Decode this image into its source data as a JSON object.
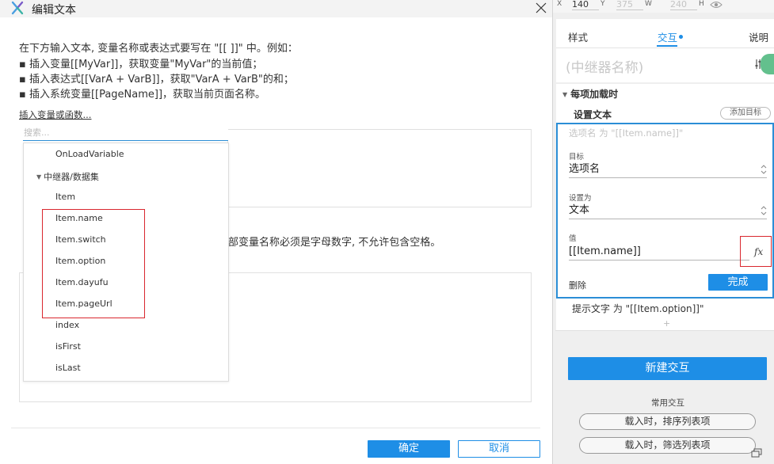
{
  "dialog": {
    "title": "编辑文本",
    "instructions": [
      "在下方输入文本, 变量名称或表达式要写在 \"[[ ]]\" 中。例如：",
      "▪ 插入变量[[MyVar]]，获取变量\"MyVar\"的当前值；",
      "▪ 插入表达式[[VarA + VarB]]，获取\"VarA + VarB\"的和；",
      "▪ 插入系统变量[[PageName]]，获取当前页面名称。"
    ],
    "insert_link": "插入变量或函数...",
    "local_var_note": "部变量名称必须是字母数字, 不允许包含空格。",
    "ok_label": "确定",
    "cancel_label": "取消"
  },
  "dropdown": {
    "search_placeholder": "搜索...",
    "items": [
      {
        "label": "OnLoadVariable",
        "group": false
      },
      {
        "label": "中继器/数据集",
        "group": true
      },
      {
        "label": "Item",
        "group": false
      },
      {
        "label": "Item.name",
        "group": false
      },
      {
        "label": "Item.switch",
        "group": false
      },
      {
        "label": "Item.option",
        "group": false
      },
      {
        "label": "Item.dayufu",
        "group": false
      },
      {
        "label": "Item.pageUrl",
        "group": false
      },
      {
        "label": "index",
        "group": false
      },
      {
        "label": "isFirst",
        "group": false
      },
      {
        "label": "isLast",
        "group": false
      }
    ]
  },
  "coords": {
    "x_label": "X",
    "x_value": "140",
    "y_label": "Y",
    "y_value": "375",
    "w_label": "W",
    "w_value": "240",
    "h_label": "H"
  },
  "panel": {
    "tabs": [
      "样式",
      "交互",
      "说明"
    ],
    "widget_name": "(中继器名称)",
    "event": "每项加载时",
    "action_title": "设置文本",
    "add_target": "添加目标",
    "action_desc": "选项名 为 \"[[Item.name]]\"",
    "target_label": "目标",
    "target_value": "选项名",
    "set_to_label": "设置为",
    "set_to_value": "文本",
    "value_label": "值",
    "value_value": "[[Item.name]]",
    "fx": "fx",
    "delete_label": "删除",
    "done_label": "完成",
    "next_action": "提示文字 为 \"[[Item.option]]\"",
    "plus": "+",
    "new_interaction": "新建交互",
    "common_label": "常用交互",
    "common_actions": [
      "载入时，排序列表项",
      "载入时，筛选列表项"
    ]
  },
  "colors": {
    "accent": "#1e8ee6",
    "highlight": "#d9272e",
    "green_bubble": "#63c08d"
  },
  "icons": [
    "logo-icon",
    "close-icon",
    "eye-icon",
    "tune-icon",
    "fx-icon",
    "chevron-down-icon",
    "spinner-icon",
    "corner-icon"
  ]
}
